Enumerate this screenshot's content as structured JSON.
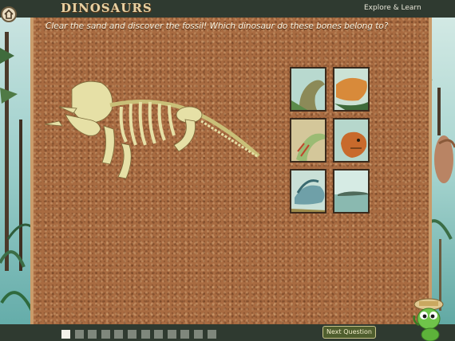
{
  "header": {
    "logo_text": "DINOSAURS",
    "menu_label": "Explore & Learn"
  },
  "question": "Clear the sand and discover the fossil! Which dinosaur do these bones belong to?",
  "fossil": {
    "name": "triceratops-skeleton"
  },
  "choices": [
    {
      "name": "choice-brontosaurus",
      "color": "#7fb3a4"
    },
    {
      "name": "choice-orange-dinosaur",
      "color": "#d88a3a"
    },
    {
      "name": "choice-striped-dinosaur",
      "color": "#9bbb74"
    },
    {
      "name": "choice-turtle-head",
      "color": "#c86a2c"
    },
    {
      "name": "choice-crested-dinosaur",
      "color": "#6fa0a8"
    },
    {
      "name": "choice-crocodile",
      "color": "#8ab9b0"
    }
  ],
  "progress": {
    "total": 12,
    "current": 1
  },
  "footer": {
    "next_label": "Next Question"
  },
  "colors": {
    "sand": "#a86b41",
    "bar": "#2f3a30",
    "bone": "#e6e0a6"
  }
}
